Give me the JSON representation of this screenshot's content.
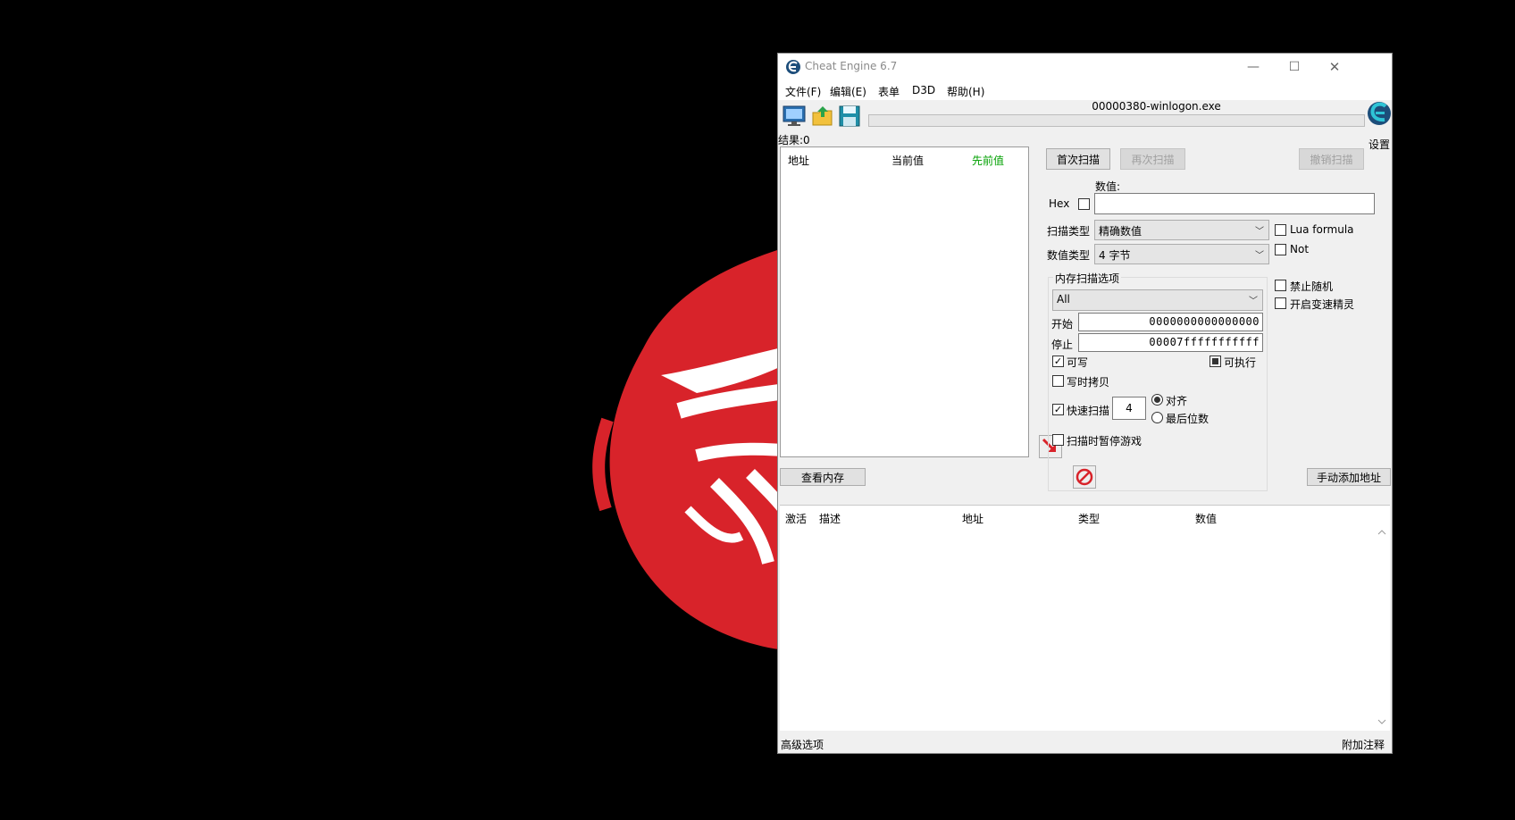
{
  "window": {
    "title": "Cheat Engine 6.7",
    "minimize_glyph": "—",
    "maximize_glyph": "☐",
    "close_glyph": "✕"
  },
  "menu": [
    "文件(F)",
    "编辑(E)",
    "表单",
    "D3D",
    "帮助(H)"
  ],
  "toolbar": {
    "process_name": "00000380-winlogon.exe",
    "settings_label": "设置",
    "icons": [
      "computer-icon",
      "open-folder-icon",
      "save-icon"
    ]
  },
  "results": {
    "label": "结果:0"
  },
  "found_list": {
    "columns": [
      "地址",
      "当前值",
      "先前值"
    ],
    "previous_value_color": "#00a000"
  },
  "scan": {
    "first_scan": "首次扫描",
    "next_scan": "再次扫描",
    "undo_scan": "撤销扫描",
    "value_label": "数值:",
    "hex_label": "Hex",
    "value": "",
    "scan_type_label": "扫描类型",
    "scan_type_value": "精确数值",
    "value_type_label": "数值类型",
    "value_type_value": "4 字节",
    "lua_formula": "Lua formula",
    "not_label": "Not",
    "memory_options_label": "内存扫描选项",
    "memory_region": "All",
    "start_label": "开始",
    "start_value": "0000000000000000",
    "stop_label": "停止",
    "stop_value": "00007fffffffffff",
    "writable": "可写",
    "executable": "可执行",
    "copy_on_write": "写时拷贝",
    "fast_scan": "快速扫描",
    "fast_scan_value": "4",
    "alignment": "对齐",
    "last_digits": "最后位数",
    "pause_game": "扫描时暂停游戏",
    "no_random": "禁止随机",
    "speedhack": "开启变速精灵"
  },
  "buttons": {
    "view_memory": "查看内存",
    "add_manually": "手动添加地址"
  },
  "address_table": {
    "columns": [
      "激活",
      "描述",
      "地址",
      "类型",
      "数值"
    ]
  },
  "statusbar": {
    "left": "高级选项",
    "right": "附加注释"
  }
}
